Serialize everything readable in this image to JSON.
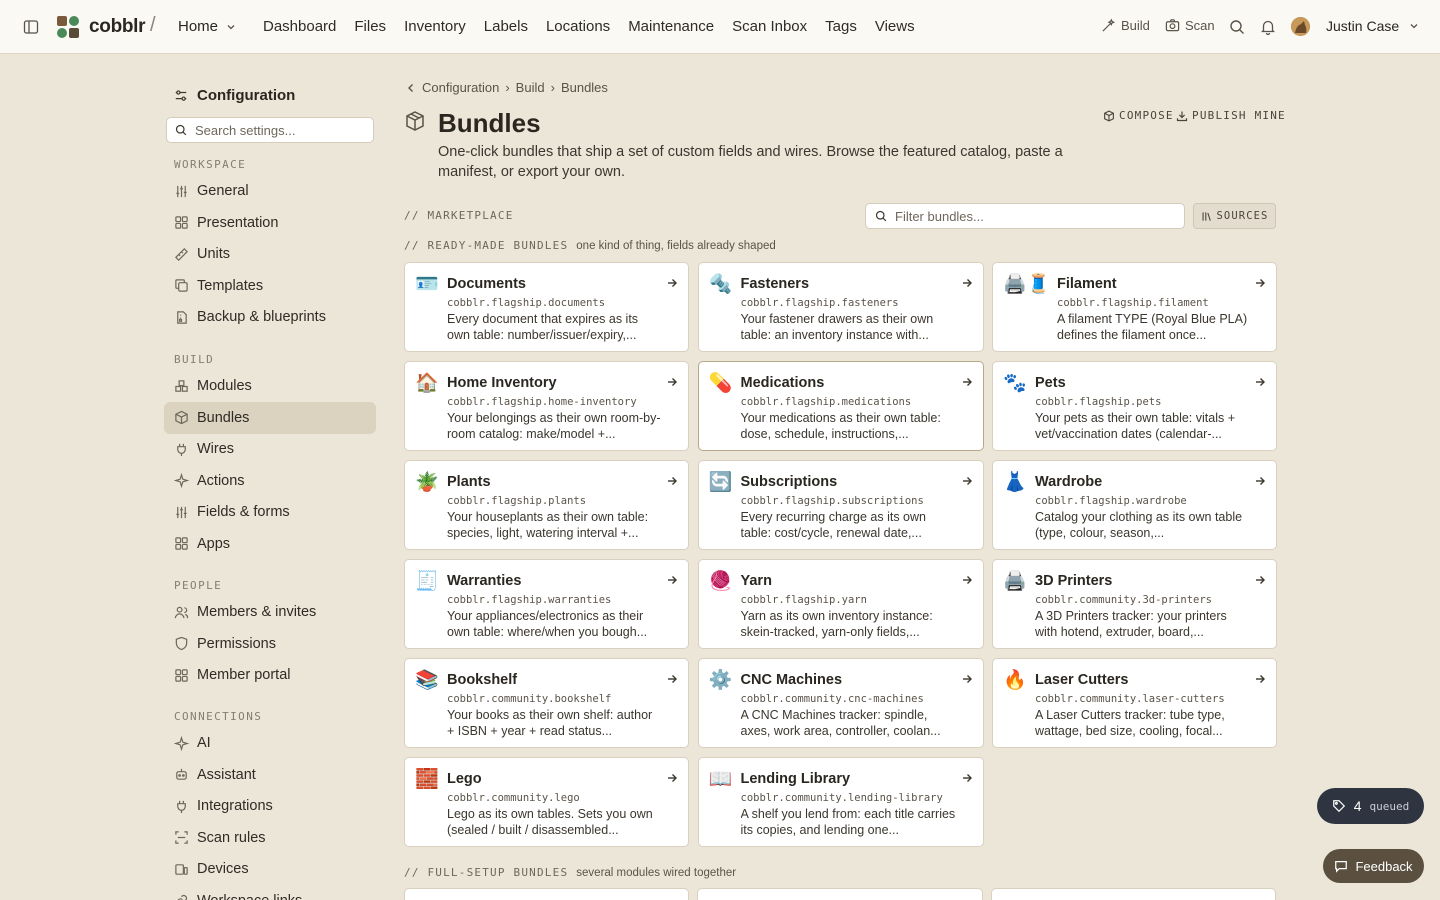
{
  "topbar": {
    "brand": "cobblr",
    "separator": "/",
    "workspace_selector": "Home",
    "nav": [
      "Dashboard",
      "Files",
      "Inventory",
      "Labels",
      "Locations",
      "Maintenance",
      "Scan Inbox",
      "Tags",
      "Views"
    ],
    "build_label": "Build",
    "scan_label": "Scan",
    "user_name": "Justin Case"
  },
  "sidebar": {
    "title": "Configuration",
    "search_placeholder": "Search settings...",
    "sections": [
      {
        "label": "WORKSPACE",
        "items": [
          {
            "label": "General",
            "icon": "sliders-icon"
          },
          {
            "label": "Presentation",
            "icon": "grid-icon"
          },
          {
            "label": "Units",
            "icon": "ruler-icon"
          },
          {
            "label": "Templates",
            "icon": "copy-icon"
          },
          {
            "label": "Backup & blueprints",
            "icon": "file-archive-icon"
          }
        ]
      },
      {
        "label": "BUILD",
        "items": [
          {
            "label": "Modules",
            "icon": "boxes-icon"
          },
          {
            "label": "Bundles",
            "icon": "package-icon",
            "active": true
          },
          {
            "label": "Wires",
            "icon": "plug-icon"
          },
          {
            "label": "Actions",
            "icon": "sparkle-icon"
          },
          {
            "label": "Fields & forms",
            "icon": "sliders-icon"
          },
          {
            "label": "Apps",
            "icon": "grid-icon"
          }
        ]
      },
      {
        "label": "PEOPLE",
        "items": [
          {
            "label": "Members & invites",
            "icon": "users-icon"
          },
          {
            "label": "Permissions",
            "icon": "shield-icon"
          },
          {
            "label": "Member portal",
            "icon": "grid-icon"
          }
        ]
      },
      {
        "label": "CONNECTIONS",
        "items": [
          {
            "label": "AI",
            "icon": "sparkle-icon"
          },
          {
            "label": "Assistant",
            "icon": "bot-icon"
          },
          {
            "label": "Integrations",
            "icon": "plug-icon"
          },
          {
            "label": "Scan rules",
            "icon": "scan-icon"
          },
          {
            "label": "Devices",
            "icon": "devices-icon"
          },
          {
            "label": "Workspace links",
            "icon": "link-icon"
          }
        ]
      }
    ]
  },
  "main": {
    "breadcrumb": [
      "Configuration",
      "Build",
      "Bundles"
    ],
    "title": "Bundles",
    "description": "One-click bundles that ship a set of custom fields and wires. Browse the featured catalog, paste a manifest, or export your own.",
    "compose_label": "COMPOSE",
    "publish_label": "PUBLISH MINE",
    "marketplace_label": "// MARKETPLACE",
    "filter_placeholder": "Filter bundles...",
    "sources_label": "SOURCES",
    "ready_label": "// READY-MADE BUNDLES",
    "ready_sub": "one kind of thing, fields already shaped",
    "full_label": "// FULL-SETUP BUNDLES",
    "full_sub": "several modules wired together",
    "bundles": [
      {
        "emoji": "🪪",
        "name": "Documents",
        "id": "cobblr.flagship.documents",
        "desc": "Every document that expires as its own table: number/issuer/expiry,..."
      },
      {
        "emoji": "🔩",
        "name": "Fasteners",
        "id": "cobblr.flagship.fasteners",
        "desc": "Your fastener drawers as their own table: an inventory instance with..."
      },
      {
        "emoji": "🖨️🧵",
        "name": "Filament",
        "id": "cobblr.flagship.filament",
        "desc": "A filament TYPE (Royal Blue PLA) defines the filament once...",
        "wide": true
      },
      {
        "emoji": "🏠",
        "name": "Home Inventory",
        "id": "cobblr.flagship.home-inventory",
        "desc": "Your belongings as their own room-by-room catalog: make/model +..."
      },
      {
        "emoji": "💊",
        "name": "Medications",
        "id": "cobblr.flagship.medications",
        "desc": "Your medications as their own table: dose, schedule, instructions,...",
        "highlight": true
      },
      {
        "emoji": "🐾",
        "name": "Pets",
        "id": "cobblr.flagship.pets",
        "desc": "Your pets as their own table: vitals + vet/vaccination dates (calendar-..."
      },
      {
        "emoji": "🪴",
        "name": "Plants",
        "id": "cobblr.flagship.plants",
        "desc": "Your houseplants as their own table: species, light, watering interval +..."
      },
      {
        "emoji": "🔄",
        "name": "Subscriptions",
        "id": "cobblr.flagship.subscriptions",
        "desc": "Every recurring charge as its own table: cost/cycle, renewal date,..."
      },
      {
        "emoji": "👗",
        "name": "Wardrobe",
        "id": "cobblr.flagship.wardrobe",
        "desc": "Catalog your clothing as its own table (type, colour, season,..."
      },
      {
        "emoji": "🧾",
        "name": "Warranties",
        "id": "cobblr.flagship.warranties",
        "desc": "Your appliances/electronics as their own table: where/when you bough..."
      },
      {
        "emoji": "🧶",
        "name": "Yarn",
        "id": "cobblr.flagship.yarn",
        "desc": "Yarn as its own inventory instance: skein-tracked, yarn-only fields,..."
      },
      {
        "emoji": "🖨️",
        "name": "3D Printers",
        "id": "cobblr.community.3d-printers",
        "desc": "A 3D Printers tracker: your printers with hotend, extruder, board,..."
      },
      {
        "emoji": "📚",
        "name": "Bookshelf",
        "id": "cobblr.community.bookshelf",
        "desc": "Your books as their own shelf: author + ISBN + year + read status..."
      },
      {
        "emoji": "⚙️",
        "name": "CNC Machines",
        "id": "cobblr.community.cnc-machines",
        "desc": "A CNC Machines tracker: spindle, axes, work area, controller, coolan..."
      },
      {
        "emoji": "🔥",
        "name": "Laser Cutters",
        "id": "cobblr.community.laser-cutters",
        "desc": "A Laser Cutters tracker: tube type, wattage, bed size, cooling, focal..."
      },
      {
        "emoji": "🧱",
        "name": "Lego",
        "id": "cobblr.community.lego",
        "desc": "Lego as its own tables. Sets you own (sealed / built / disassembled..."
      },
      {
        "emoji": "📖",
        "name": "Lending Library",
        "id": "cobblr.community.lending-library",
        "desc": "A shelf you lend from: each title carries its copies, and lending one..."
      }
    ]
  },
  "queued": {
    "count": "4",
    "label": "queued"
  },
  "feedback_label": "Feedback"
}
